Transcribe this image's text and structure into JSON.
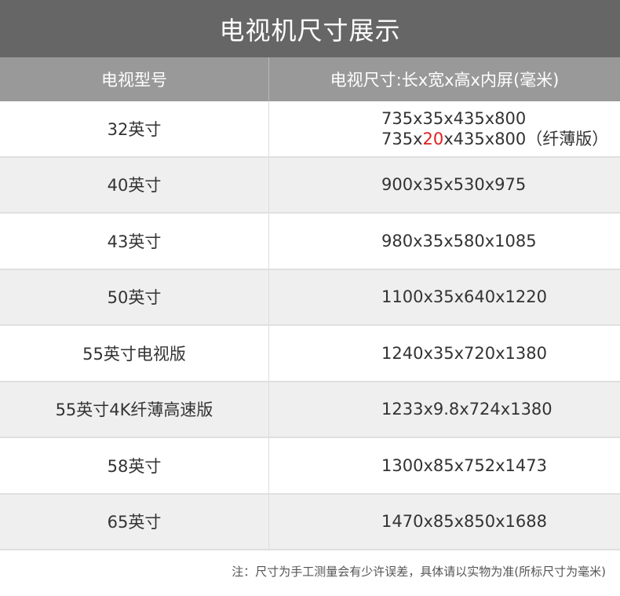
{
  "title": "电视机尺寸展示",
  "header": {
    "model": "电视型号",
    "size": "电视尺寸:长x宽x高x内屏(毫米)"
  },
  "rows": [
    {
      "model": "32英寸",
      "size": "735x35x435x800",
      "size2_pre": "735x",
      "size2_highlight": "20",
      "size2_post": "x435x800（纤薄版）"
    },
    {
      "model": "40英寸",
      "size": "900x35x530x975"
    },
    {
      "model": "43英寸",
      "size": "980x35x580x1085"
    },
    {
      "model": "50英寸",
      "size": "1100x35x640x1220"
    },
    {
      "model": "55英寸电视版",
      "size": "1240x35x720x1380"
    },
    {
      "model": "55英寸4K纤薄高速版",
      "size": "1233x9.8x724x1380"
    },
    {
      "model": "58英寸",
      "size": "1300x85x752x1473"
    },
    {
      "model": "65英寸",
      "size": "1470x85x850x1688"
    }
  ],
  "footnote": "注：尺寸为手工测量会有少许误差，具体请以实物为准(所标尺寸为毫米)",
  "colors": {
    "title_bg": "#666666",
    "header_bg": "#999999",
    "alt_row": "#efefef",
    "highlight": "#e02020"
  }
}
